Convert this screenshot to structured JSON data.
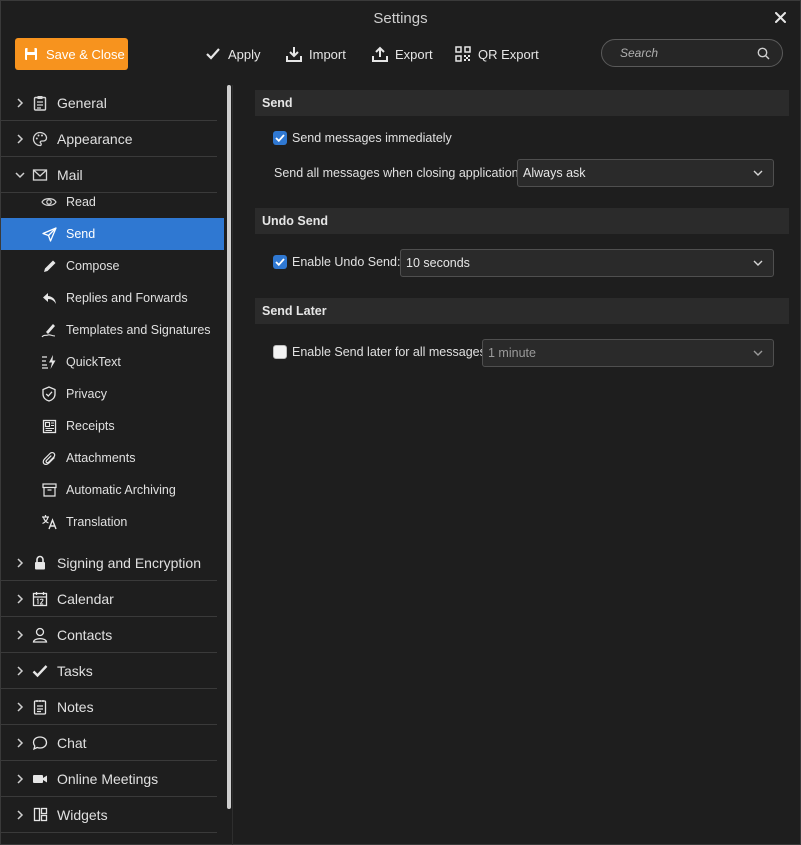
{
  "window": {
    "title": "Settings"
  },
  "toolbar": {
    "save_close": "Save & Close",
    "apply": "Apply",
    "import": "Import",
    "export": "Export",
    "qr_export": "QR Export",
    "search_placeholder": "Search"
  },
  "sidebar": {
    "categories": [
      {
        "label": "General",
        "icon": "clipboard-icon"
      },
      {
        "label": "Appearance",
        "icon": "palette-icon"
      },
      {
        "label": "Mail",
        "icon": "envelope-icon",
        "expanded": true
      },
      {
        "label": "Signing and Encryption",
        "icon": "lock-icon"
      },
      {
        "label": "Calendar",
        "icon": "calendar-icon"
      },
      {
        "label": "Contacts",
        "icon": "person-icon"
      },
      {
        "label": "Tasks",
        "icon": "checkmark-icon"
      },
      {
        "label": "Notes",
        "icon": "notepad-icon"
      },
      {
        "label": "Chat",
        "icon": "chat-bubble-icon"
      },
      {
        "label": "Online Meetings",
        "icon": "video-camera-icon"
      },
      {
        "label": "Widgets",
        "icon": "widgets-grid-icon"
      }
    ],
    "mail_items": [
      {
        "label": "Read",
        "icon": "eye-icon"
      },
      {
        "label": "Send",
        "icon": "paper-plane-icon",
        "active": true
      },
      {
        "label": "Compose",
        "icon": "pencil-icon"
      },
      {
        "label": "Replies and Forwards",
        "icon": "reply-arrow-icon"
      },
      {
        "label": "Templates and Signatures",
        "icon": "signature-pen-icon"
      },
      {
        "label": "QuickText",
        "icon": "quicktext-bolt-icon"
      },
      {
        "label": "Privacy",
        "icon": "shield-check-icon"
      },
      {
        "label": "Receipts",
        "icon": "receipt-icon"
      },
      {
        "label": "Attachments",
        "icon": "paperclip-icon"
      },
      {
        "label": "Automatic Archiving",
        "icon": "archive-box-icon"
      },
      {
        "label": "Translation",
        "icon": "translate-icon"
      }
    ]
  },
  "content": {
    "send": {
      "header": "Send",
      "send_immediately_label": "Send messages immediately",
      "send_immediately_checked": true,
      "closing_label": "Send all messages when closing application:",
      "closing_value": "Always ask"
    },
    "undo_send": {
      "header": "Undo Send",
      "enable_label": "Enable Undo Send:",
      "enable_checked": true,
      "delay_value": "10 seconds"
    },
    "send_later": {
      "header": "Send Later",
      "enable_label": "Enable Send later for all messages:",
      "enable_checked": false,
      "delay_value": "1 minute"
    }
  },
  "colors": {
    "accent": "#f7931e",
    "selection": "#2f78d2",
    "background": "#1e1e1e"
  }
}
